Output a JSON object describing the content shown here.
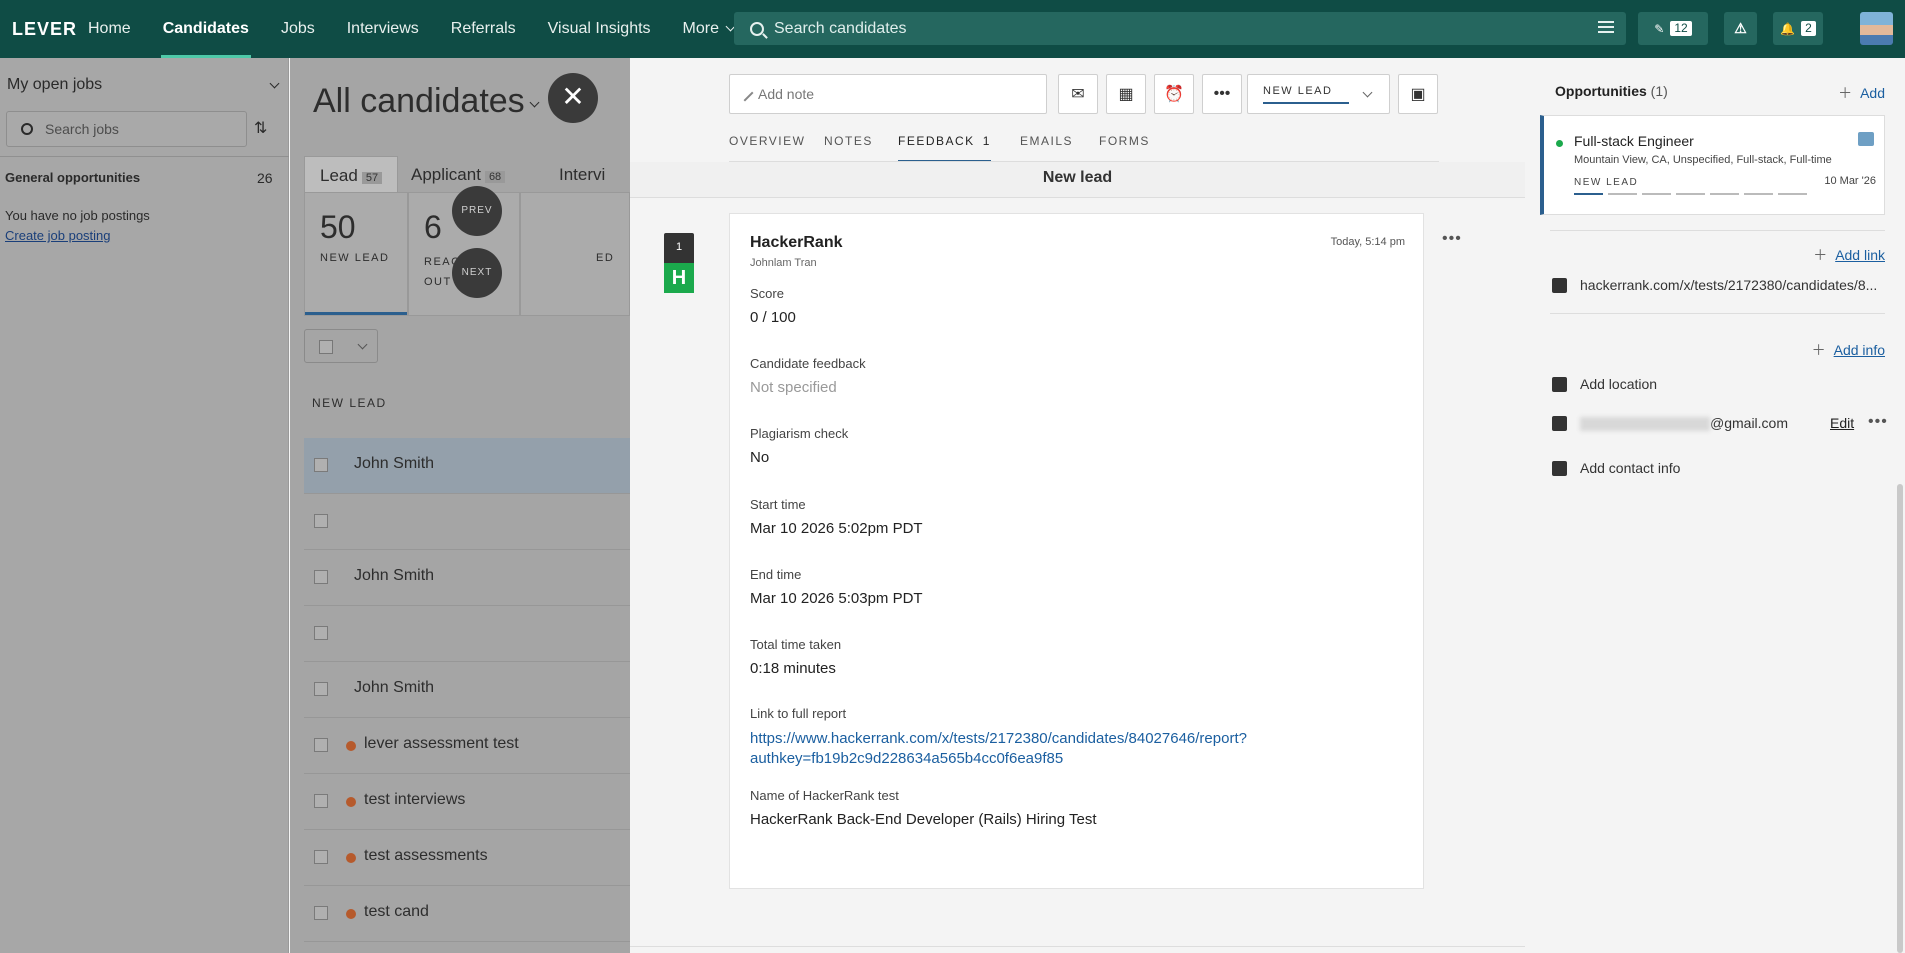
{
  "nav": {
    "logo": "LEVER",
    "items": [
      "Home",
      "Candidates",
      "Jobs",
      "Interviews",
      "Referrals",
      "Visual Insights",
      "More"
    ],
    "search_placeholder": "Search candidates",
    "edit_count": "12",
    "notif_count": "2"
  },
  "left": {
    "title": "My open jobs",
    "search_placeholder": "Search jobs",
    "general": "General opportunities",
    "general_count": "26",
    "none": "You have no job postings",
    "create": "Create job posting"
  },
  "middle": {
    "title": "All candidates",
    "tabs": [
      {
        "label": "Lead",
        "count": "57"
      },
      {
        "label": "Applicant",
        "count": "68"
      },
      {
        "label": "Intervi",
        "count": ""
      }
    ],
    "stages": [
      {
        "num": "50",
        "label": "NEW LEAD"
      },
      {
        "num": "6",
        "label": "REACHED\nOUT"
      },
      {
        "num": "",
        "label": "ED"
      }
    ],
    "prev": "PREV",
    "next": "NEXT",
    "group": "NEW LEAD",
    "rows": [
      {
        "name": "John Smith",
        "dot": false,
        "selected": true
      },
      {
        "name": "",
        "dot": false,
        "selected": false
      },
      {
        "name": "John Smith",
        "dot": false,
        "selected": false
      },
      {
        "name": "",
        "dot": false,
        "selected": false
      },
      {
        "name": "John Smith",
        "dot": false,
        "selected": false
      },
      {
        "name": "lever assessment test",
        "dot": true,
        "selected": false
      },
      {
        "name": "test interviews",
        "dot": true,
        "selected": false
      },
      {
        "name": "test assessments",
        "dot": true,
        "selected": false
      },
      {
        "name": "test cand",
        "dot": true,
        "selected": false
      }
    ]
  },
  "panel": {
    "note_placeholder": "Add note",
    "stage": "NEW LEAD",
    "tabs": [
      {
        "label": "OVERVIEW",
        "count": ""
      },
      {
        "label": "NOTES",
        "count": ""
      },
      {
        "label": "FEEDBACK",
        "count": "1"
      },
      {
        "label": "EMAILS",
        "count": ""
      },
      {
        "label": "FORMS",
        "count": ""
      }
    ],
    "subhead": "New lead",
    "feedback_num": "1",
    "feedback_icon": "H",
    "card": {
      "title": "HackerRank",
      "author": "Johnlam Tran",
      "time": "Today, 5:14 pm",
      "fields": [
        {
          "q": "Score",
          "a": "0 / 100"
        },
        {
          "q": "Candidate feedback",
          "a": "Not specified"
        },
        {
          "q": "Plagiarism check",
          "a": "No"
        },
        {
          "q": "Start time",
          "a": "Mar 10 2026 5:02pm PDT"
        },
        {
          "q": "End time",
          "a": "Mar 10 2026 5:03pm PDT"
        },
        {
          "q": "Total time taken",
          "a": "0:18 minutes"
        },
        {
          "q": "Link to full report",
          "a": "https://www.hackerrank.com/x/tests/2172380/candidates/84027646/report?\nauthkey=fb19b2c9d228634a565b4cc0f6ea9f85"
        },
        {
          "q": "Name of HackerRank test",
          "a": "HackerRank Back-End Developer (Rails) Hiring Test"
        }
      ]
    }
  },
  "right": {
    "opp_title": "Opportunities",
    "opp_count": "(1)",
    "add": "Add",
    "job": "Full-stack Engineer",
    "location": "Mountain View, CA, Unspecified, Full-stack, Full-time",
    "stage": "NEW LEAD",
    "date": "10 Mar '26",
    "add_link": "Add link",
    "link": "hackerrank.com/x/tests/2172380/candidates/8...",
    "add_info": "Add info",
    "add_location": "Add location",
    "email_suffix": "@gmail.com",
    "edit": "Edit",
    "add_contact": "Add contact info"
  },
  "colors": {
    "nav": "#0f4c45",
    "accent": "#2b5f8e",
    "hackerrank": "#1ba94c",
    "link": "#1b5fa0"
  }
}
